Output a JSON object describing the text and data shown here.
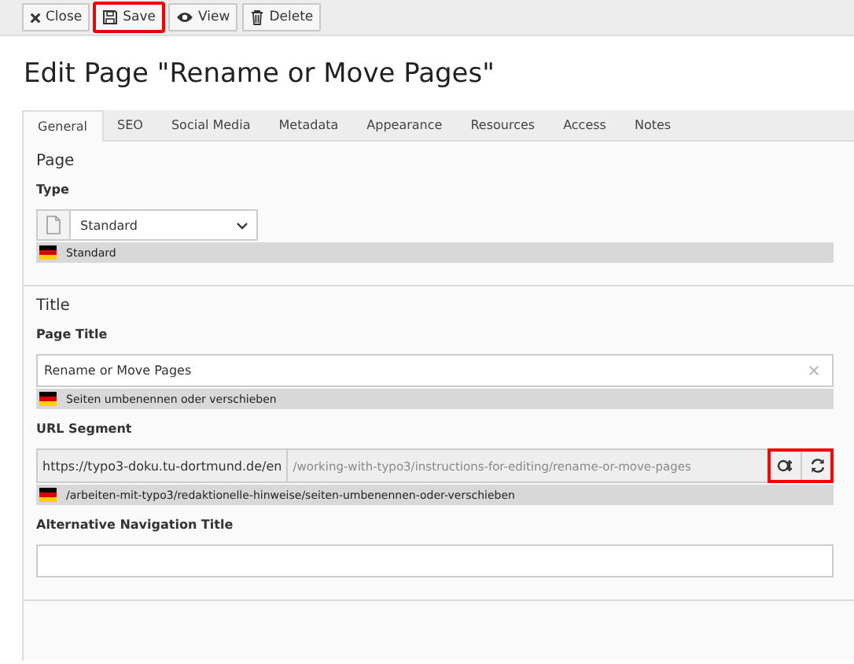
{
  "toolbar": [
    {
      "kind": "close",
      "label": "Close",
      "highlighted": false
    },
    {
      "kind": "save",
      "label": "Save",
      "highlighted": true
    },
    {
      "kind": "view",
      "label": "View",
      "highlighted": false
    },
    {
      "kind": "delete",
      "label": "Delete",
      "highlighted": false
    }
  ],
  "heading": "Edit Page \"Rename or Move Pages\"",
  "tabs": [
    {
      "label": "General",
      "selected": true
    },
    {
      "label": "SEO",
      "selected": false
    },
    {
      "label": "Social Media",
      "selected": false
    },
    {
      "label": "Metadata",
      "selected": false
    },
    {
      "label": "Appearance",
      "selected": false
    },
    {
      "label": "Resources",
      "selected": false
    },
    {
      "label": "Access",
      "selected": false
    },
    {
      "label": "Notes",
      "selected": false
    }
  ],
  "sections": [
    {
      "title": "Page",
      "fields": [
        {
          "kind": "select",
          "label": "Type",
          "value": "Standard",
          "translation": "Standard"
        }
      ]
    },
    {
      "title": "Title",
      "fields": [
        {
          "kind": "text",
          "label": "Page Title",
          "value": "Rename or Move Pages",
          "clearable": true,
          "translation": "Seiten umbenennen oder verschieben"
        },
        {
          "kind": "slug",
          "label": "URL Segment",
          "prefix": "https://typo3-doku.tu-dortmund.de/en",
          "value": "/working-with-typo3/instructions-for-editing/rename-or-move-pages",
          "buttons_highlighted": true,
          "translation": "/arbeiten-mit-typo3/redaktionelle-hinweise/seiten-umbenennen-oder-verschieben"
        },
        {
          "kind": "text",
          "label": "Alternative Navigation Title",
          "clearable": false
        }
      ]
    }
  ]
}
